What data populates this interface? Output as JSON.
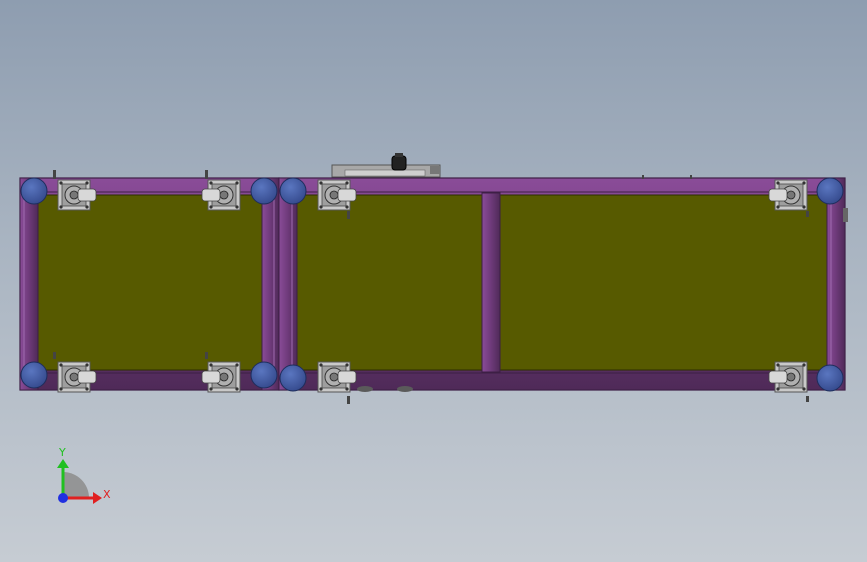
{
  "viewport": {
    "colors": {
      "background_top": "#8e9db0",
      "background_bottom": "#c6ccd3",
      "frame_purple": "#6e3a7a",
      "frame_edge": "#3d1f45",
      "panel_olive": "#575a00",
      "wheel_blue": "#3f5ca8",
      "caster_gray": "#b9b9b9"
    }
  },
  "model": {
    "modules": [
      "left-frame",
      "right-frame"
    ],
    "feet_icon": "caster-wheel-icon",
    "leveling_icon": "round-foot-icon",
    "motor_icon": "drive-motor-icon"
  },
  "triad": {
    "x_label": "X",
    "y_label": "Y",
    "x_color": "#e02020",
    "y_color": "#20c020",
    "z_color": "#2030e0"
  }
}
